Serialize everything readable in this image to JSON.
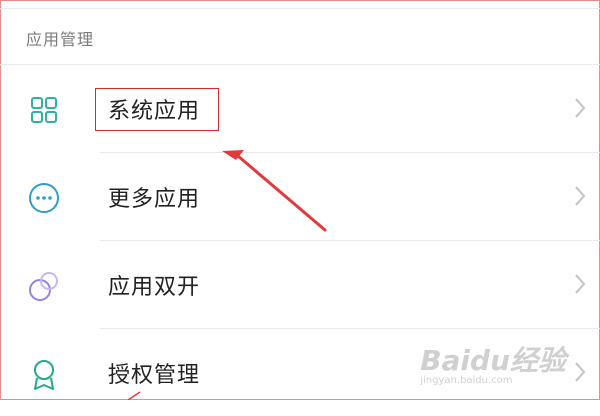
{
  "section": {
    "title": "应用管理"
  },
  "items": [
    {
      "label": "系统应用",
      "icon": "grid-icon",
      "color": "#2fb39b"
    },
    {
      "label": "更多应用",
      "icon": "more-dots-icon",
      "color": "#2aa0c8"
    },
    {
      "label": "应用双开",
      "icon": "twin-circles-icon",
      "color": "#9b7fe0"
    },
    {
      "label": "授权管理",
      "icon": "badge-icon",
      "color": "#24a88d"
    }
  ],
  "annotation": {
    "color": "#e23a3a"
  },
  "watermark": {
    "logo": "Baidu经验",
    "url": "jingyan.baidu.com"
  }
}
